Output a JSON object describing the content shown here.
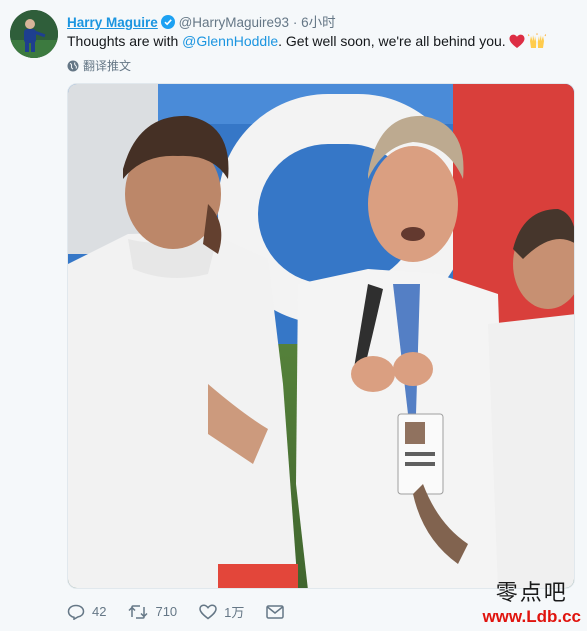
{
  "tweet": {
    "author_name": "Harry Maguire",
    "handle": "@HarryMaguire93",
    "separator": "·",
    "time": "6小时",
    "text_before": "Thoughts are with ",
    "mention": "@GlennHoddle",
    "text_after": ". Get well soon, we're all behind you.",
    "emojis": [
      "red-heart",
      "raised-hands"
    ],
    "translate_label": "翻译推文"
  },
  "actions": {
    "reply_count": "42",
    "retweet_count": "710",
    "like_count": "1万"
  },
  "watermark": {
    "text": "零点吧",
    "url": "www.Ldb.cc"
  },
  "colors": {
    "link": "#1b95e0",
    "secondary": "#657786",
    "heart": "#e0245e"
  }
}
